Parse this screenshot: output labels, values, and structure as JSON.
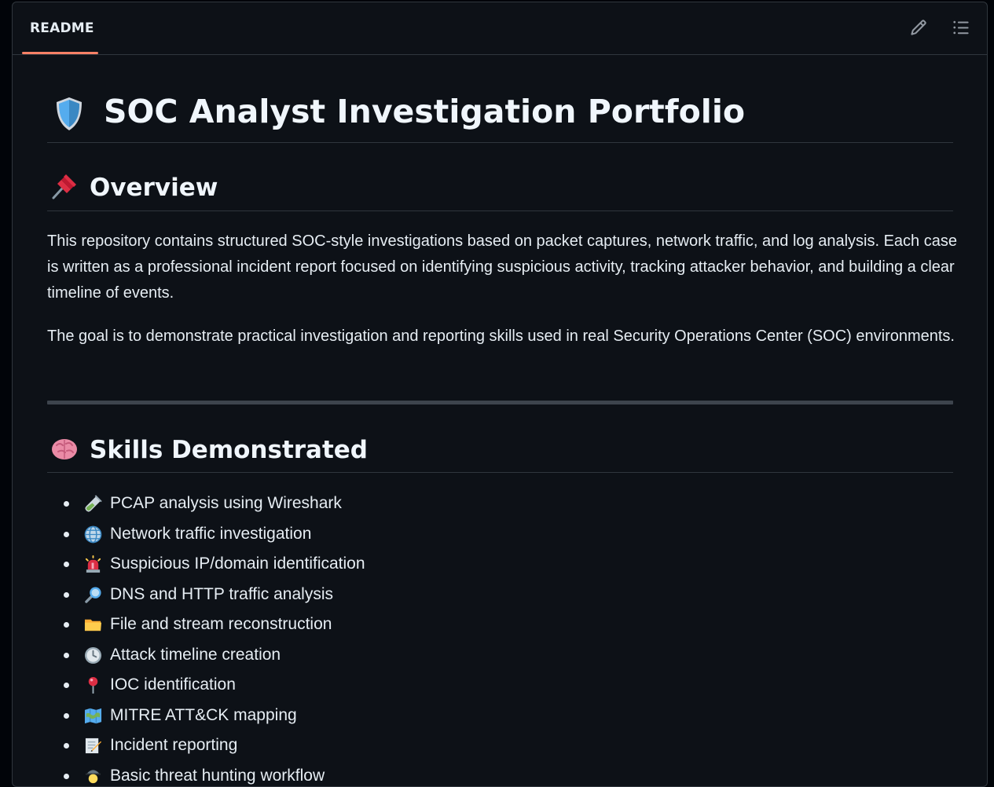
{
  "readme": {
    "tab_label": "README",
    "edit_icon": "pencil-icon",
    "toc_icon": "list-unordered-icon"
  },
  "title": {
    "icon": "shield-icon",
    "text": "SOC Analyst Investigation Portfolio"
  },
  "overview": {
    "icon": "pushpin-icon",
    "heading": "Overview",
    "paragraph1": "This repository contains structured SOC-style investigations based on packet captures, network traffic, and log analysis. Each case is written as a professional incident report focused on identifying suspicious activity, tracking attacker behavior, and building a clear timeline of events.",
    "paragraph2": "The goal is to demonstrate practical investigation and reporting skills used in real Security Operations Center (SOC) environments."
  },
  "skills": {
    "icon": "brain-icon",
    "heading": "Skills Demonstrated",
    "items": [
      {
        "icon": "test-tube-icon",
        "label": "PCAP analysis using Wireshark"
      },
      {
        "icon": "globe-icon",
        "label": "Network traffic investigation"
      },
      {
        "icon": "siren-icon",
        "label": "Suspicious IP/domain identification"
      },
      {
        "icon": "magnifier-icon",
        "label": "DNS and HTTP traffic analysis"
      },
      {
        "icon": "folder-icon",
        "label": "File and stream reconstruction"
      },
      {
        "icon": "clock-icon",
        "label": "Attack timeline creation"
      },
      {
        "icon": "round-pushpin-icon",
        "label": "IOC identification"
      },
      {
        "icon": "map-icon",
        "label": "MITRE ATT&CK mapping"
      },
      {
        "icon": "memo-icon",
        "label": "Incident reporting"
      },
      {
        "icon": "detective-icon",
        "label": "Basic threat hunting workflow"
      }
    ]
  }
}
